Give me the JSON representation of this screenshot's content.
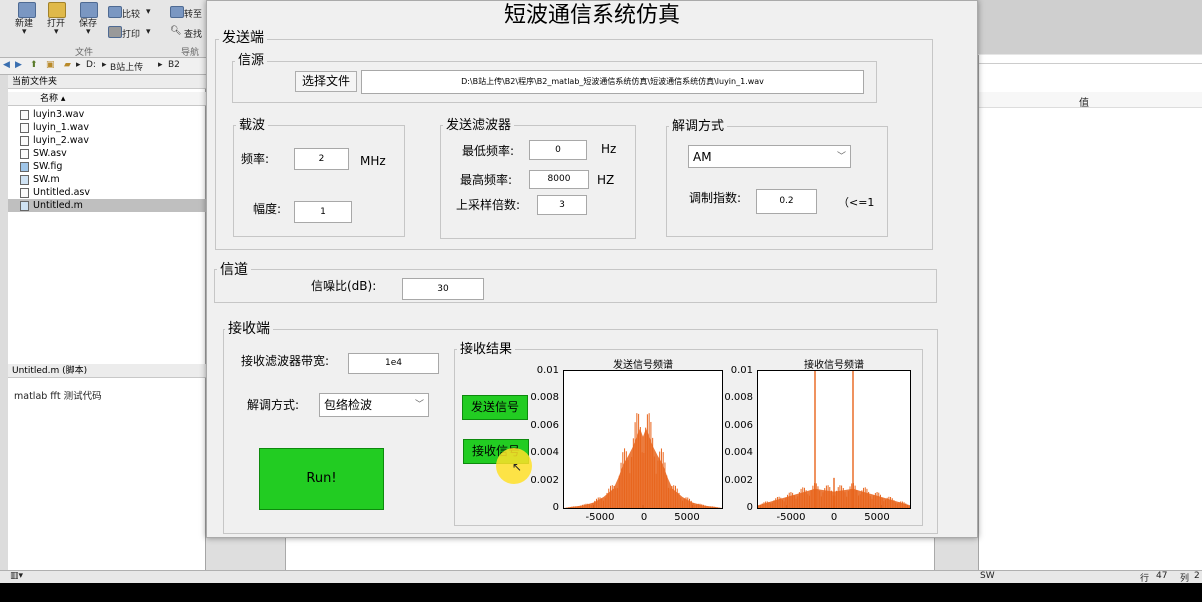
{
  "matlab": {
    "ribbon": {
      "new": "新建",
      "open": "打开",
      "save": "保存",
      "compare": "比较",
      "print": "打印",
      "goto": "转至",
      "find": "查找",
      "section_file": "文件",
      "section_nav": "导航"
    },
    "address": [
      "D:",
      "B站上传",
      "B2"
    ],
    "current_folder_label": "当前文件夹",
    "name_column": "名称 ▴",
    "files": [
      "luyin3.wav",
      "luyin_1.wav",
      "luyin_2.wav",
      "SW.asv",
      "SW.fig",
      "SW.m",
      "Untitled.asv",
      "Untitled.m"
    ],
    "selected_file_index": 7,
    "details_title": "Untitled.m  (脚本)",
    "details_text": "matlab fft 测试代码",
    "workspace_value_header": "值",
    "status": {
      "file": "SW",
      "line_label": "行",
      "line": "47",
      "col_label": "列",
      "col": "2"
    }
  },
  "figure": {
    "title": "短波通信系统仿真",
    "sender": {
      "title": "发送端",
      "source": {
        "title": "信源",
        "choose_file_label": "选择文件",
        "file_path": "D:\\B站上传\\B2\\程序\\B2_matlab_短波通信系统仿真\\短波通信系统仿真\\luyin_1.wav"
      },
      "carrier": {
        "title": "载波",
        "freq_label": "频率:",
        "freq_value": "2",
        "freq_unit": "MHz",
        "amp_label": "幅度:",
        "amp_value": "1"
      },
      "filter": {
        "title": "发送滤波器",
        "fmin_label": "最低频率:",
        "fmin_value": "0",
        "fmin_unit": "Hz",
        "fmax_label": "最高频率:",
        "fmax_value": "8000",
        "fmax_unit": "HZ",
        "upsample_label": "上采样倍数:",
        "upsample_value": "3"
      },
      "modulation": {
        "title": "解调方式",
        "selected": "AM",
        "index_label": "调制指数:",
        "index_value": "0.2",
        "index_note": "（<=1"
      }
    },
    "channel": {
      "title": "信道",
      "snr_label": "信噪比(dB):",
      "snr_value": "30"
    },
    "receiver": {
      "title": "接收端",
      "bw_label": "接收滤波器带宽:",
      "bw_value": "1e4",
      "demod_label": "解调方式:",
      "demod_selected": "包络检波",
      "run_label": "Run!",
      "results": {
        "title": "接收结果",
        "send_btn": "发送信号",
        "recv_btn": "接收信号"
      }
    },
    "colors": {
      "green_button": "#22cc22",
      "spectrum": "#e8641b"
    }
  },
  "chart_data": [
    {
      "type": "area",
      "title": "发送信号频谱",
      "xlabel": "",
      "ylabel": "",
      "xlim": [
        -8000,
        8000
      ],
      "ylim": [
        0,
        0.01
      ],
      "xticks": [
        "-5000",
        "0",
        "5000"
      ],
      "yticks": [
        "0",
        "0.002",
        "0.004",
        "0.006",
        "0.008",
        "0.01"
      ],
      "x": [
        -8000,
        -7000,
        -6000,
        -5000,
        -4000,
        -3000,
        -2500,
        -2000,
        -1500,
        -1000,
        -500,
        -300,
        0,
        300,
        500,
        1000,
        1500,
        2000,
        2500,
        3000,
        4000,
        5000,
        6000,
        7000,
        8000
      ],
      "y": [
        0,
        0.0001,
        0.0002,
        0.0004,
        0.0008,
        0.0014,
        0.0022,
        0.0032,
        0.0038,
        0.0045,
        0.0055,
        0.0058,
        0.0052,
        0.0058,
        0.0055,
        0.0045,
        0.0038,
        0.0032,
        0.0022,
        0.0014,
        0.0008,
        0.0004,
        0.0002,
        0.0001,
        0
      ]
    },
    {
      "type": "area",
      "title": "接收信号频谱",
      "xlabel": "",
      "ylabel": "",
      "xlim": [
        -8000,
        8000
      ],
      "ylim": [
        0,
        0.01
      ],
      "xticks": [
        "-5000",
        "0",
        "5000"
      ],
      "yticks": [
        "0",
        "0.002",
        "0.004",
        "0.006",
        "0.008",
        "0.01"
      ],
      "x": [
        -8000,
        -7000,
        -6000,
        -5000,
        -4000,
        -3000,
        -2000,
        -1000,
        0,
        1000,
        2000,
        3000,
        4000,
        5000,
        6000,
        7000,
        8000
      ],
      "y": [
        0.0002,
        0.0004,
        0.0006,
        0.0008,
        0.001,
        0.0012,
        0.0014,
        0.0013,
        0.0012,
        0.0013,
        0.0014,
        0.0012,
        0.001,
        0.0008,
        0.0006,
        0.0004,
        0.0002
      ],
      "peaks": [
        {
          "x": -2000,
          "y": 0.01
        },
        {
          "x": 0,
          "y": 0.0022
        },
        {
          "x": 2000,
          "y": 0.01
        }
      ]
    }
  ]
}
